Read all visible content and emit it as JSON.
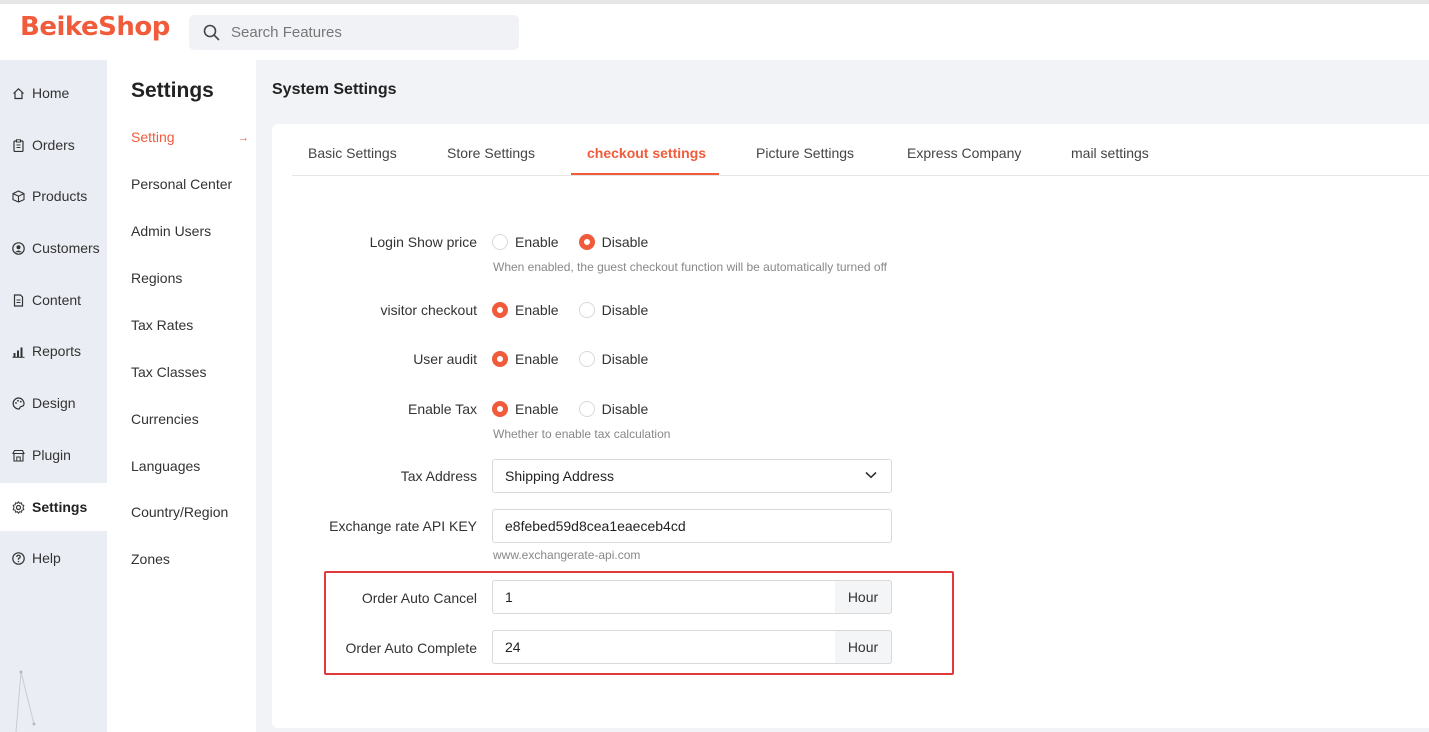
{
  "brand": {
    "logo_text": "BeikeShop",
    "accent_color": "#f05b3c"
  },
  "search": {
    "placeholder": "Search Features",
    "icon": "search-icon"
  },
  "left_nav": {
    "items": [
      {
        "label": "Home",
        "icon": "home-icon"
      },
      {
        "label": "Orders",
        "icon": "clipboard-icon"
      },
      {
        "label": "Products",
        "icon": "box-icon"
      },
      {
        "label": "Customers",
        "icon": "user-circle-icon"
      },
      {
        "label": "Content",
        "icon": "document-icon"
      },
      {
        "label": "Reports",
        "icon": "bar-chart-icon"
      },
      {
        "label": "Design",
        "icon": "palette-icon"
      },
      {
        "label": "Plugin",
        "icon": "store-icon"
      },
      {
        "label": "Settings",
        "icon": "gear-icon",
        "active": true
      },
      {
        "label": "Help",
        "icon": "question-icon"
      }
    ]
  },
  "submenu": {
    "title": "Settings",
    "items": [
      {
        "label": "Setting",
        "active": true
      },
      {
        "label": "Personal Center"
      },
      {
        "label": "Admin Users"
      },
      {
        "label": "Regions"
      },
      {
        "label": "Tax Rates"
      },
      {
        "label": "Tax Classes"
      },
      {
        "label": "Currencies"
      },
      {
        "label": "Languages"
      },
      {
        "label": "Country/Region"
      },
      {
        "label": "Zones"
      }
    ],
    "active_arrow": "→"
  },
  "main": {
    "title": "System Settings",
    "tabs": [
      {
        "label": "Basic Settings"
      },
      {
        "label": "Store Settings"
      },
      {
        "label": "checkout settings",
        "active": true
      },
      {
        "label": "Picture Settings"
      },
      {
        "label": "Express Company"
      },
      {
        "label": "mail settings"
      }
    ],
    "radio_option_labels": {
      "enable": "Enable",
      "disable": "Disable"
    },
    "fields": {
      "login_show_price": {
        "label": "Login Show price",
        "value": "Disable",
        "help": "When enabled, the guest checkout function will be automatically turned off"
      },
      "visitor_checkout": {
        "label": "visitor checkout",
        "value": "Enable"
      },
      "user_audit": {
        "label": "User audit",
        "value": "Enable"
      },
      "enable_tax": {
        "label": "Enable Tax",
        "value": "Enable",
        "help": "Whether to enable tax calculation"
      },
      "tax_address": {
        "label": "Tax Address",
        "value": "Shipping Address"
      },
      "exchange_rate_api_key": {
        "label": "Exchange rate API KEY",
        "value": "e8febed59d8cea1eaeceb4cd",
        "help": "www.exchangerate-api.com"
      },
      "order_auto_cancel": {
        "label": "Order Auto Cancel",
        "value": "1",
        "unit": "Hour"
      },
      "order_auto_complete": {
        "label": "Order Auto Complete",
        "value": "24",
        "unit": "Hour"
      }
    }
  }
}
